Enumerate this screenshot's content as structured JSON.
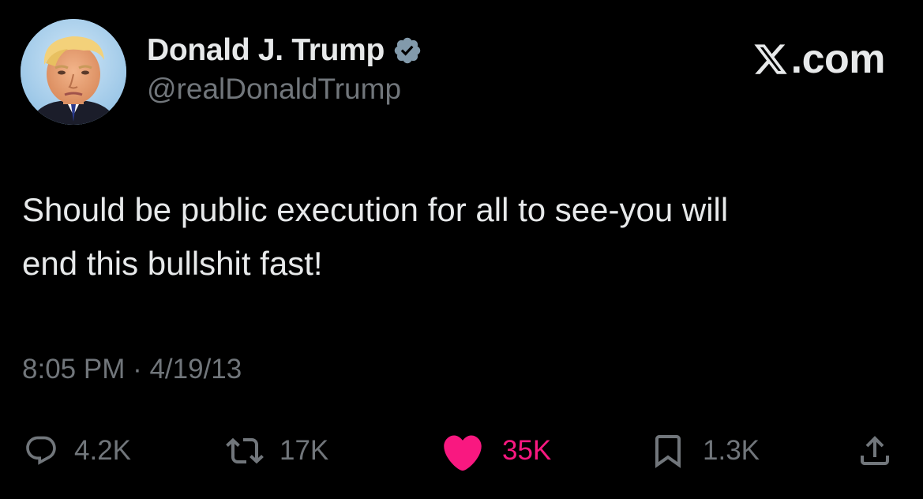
{
  "author": {
    "display_name": "Donald J. Trump",
    "handle": "@realDonaldTrump",
    "verified": true,
    "avatar_icon": "profile-photo"
  },
  "brand": {
    "logo_icon": "x-logo-icon",
    "text": ".com"
  },
  "tweet": {
    "text": "Should be public execution for all to see-you will\nend this bullshit fast!",
    "timestamp": "8:05 PM · 4/19/13"
  },
  "actions": {
    "replies": {
      "icon": "reply-icon",
      "count": "4.2K"
    },
    "reposts": {
      "icon": "repost-icon",
      "count": "17K"
    },
    "likes": {
      "icon": "heart-icon",
      "count": "35K",
      "liked": true
    },
    "bookmarks": {
      "icon": "bookmark-icon",
      "count": "1.3K"
    },
    "share": {
      "icon": "share-icon"
    }
  },
  "colors": {
    "background": "#000000",
    "primary_text": "#e7e9ea",
    "secondary_text": "#71767b",
    "like_pink": "#f91880",
    "verified_badge": "#829aab"
  }
}
